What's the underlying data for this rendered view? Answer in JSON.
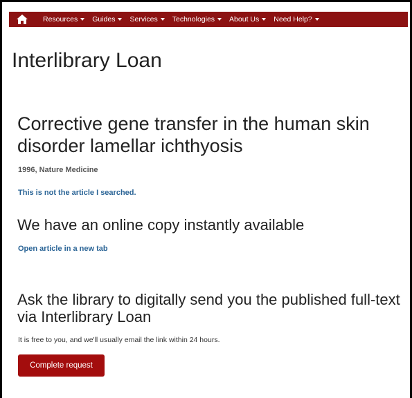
{
  "nav": {
    "home_icon": "home-icon",
    "items": [
      {
        "label": "Resources"
      },
      {
        "label": "Guides"
      },
      {
        "label": "Services"
      },
      {
        "label": "Technologies"
      },
      {
        "label": "About Us"
      },
      {
        "label": "Need Help?"
      }
    ]
  },
  "page": {
    "title": "Interlibrary Loan"
  },
  "article": {
    "title": "Corrective gene transfer in the human skin disorder lamellar ichthyosis",
    "meta": "1996, Nature Medicine",
    "wrong_article_link": "This is not the article I searched."
  },
  "online": {
    "heading": "We have an online copy instantly available",
    "open_link": "Open article in a new tab"
  },
  "ill": {
    "heading": "Ask the library to digitally send you the published full-text via Interlibrary Loan",
    "description": "It is free to you, and we'll usually email the link within 24 hours.",
    "button_label": "Complete request"
  },
  "colors": {
    "brand": "#8c1212",
    "button": "#a30d0d",
    "link": "#2a6496"
  }
}
